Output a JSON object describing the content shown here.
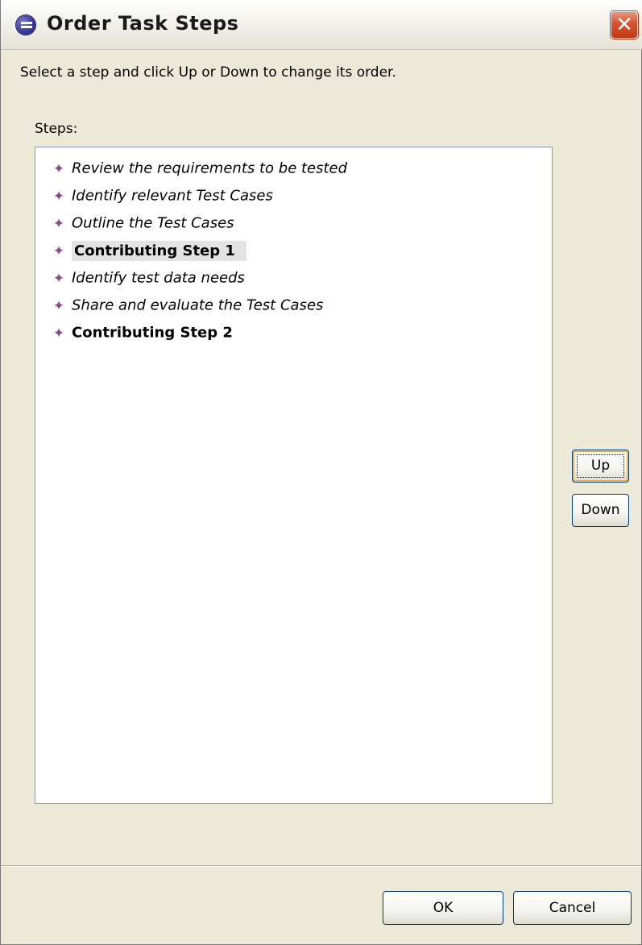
{
  "window": {
    "title": "Order Task Steps",
    "close_label": "✕"
  },
  "instruction": "Select a step and click Up or Down to change its order.",
  "steps": {
    "label": "Steps:",
    "items": [
      {
        "label": "Review the requirements to be tested",
        "style": "italic",
        "selected": false
      },
      {
        "label": "Identify relevant Test Cases",
        "style": "italic",
        "selected": false
      },
      {
        "label": "Outline the Test Cases",
        "style": "italic",
        "selected": false
      },
      {
        "label": "Contributing Step 1",
        "style": "bold",
        "selected": true
      },
      {
        "label": "Identify test data needs",
        "style": "italic",
        "selected": false
      },
      {
        "label": "Share and evaluate the Test Cases",
        "style": "italic",
        "selected": false
      },
      {
        "label": "Contributing Step 2",
        "style": "bold",
        "selected": false
      }
    ],
    "item_icon": "step-diamond-icon"
  },
  "buttons": {
    "up": "Up",
    "down": "Down",
    "ok": "OK",
    "cancel": "Cancel"
  }
}
